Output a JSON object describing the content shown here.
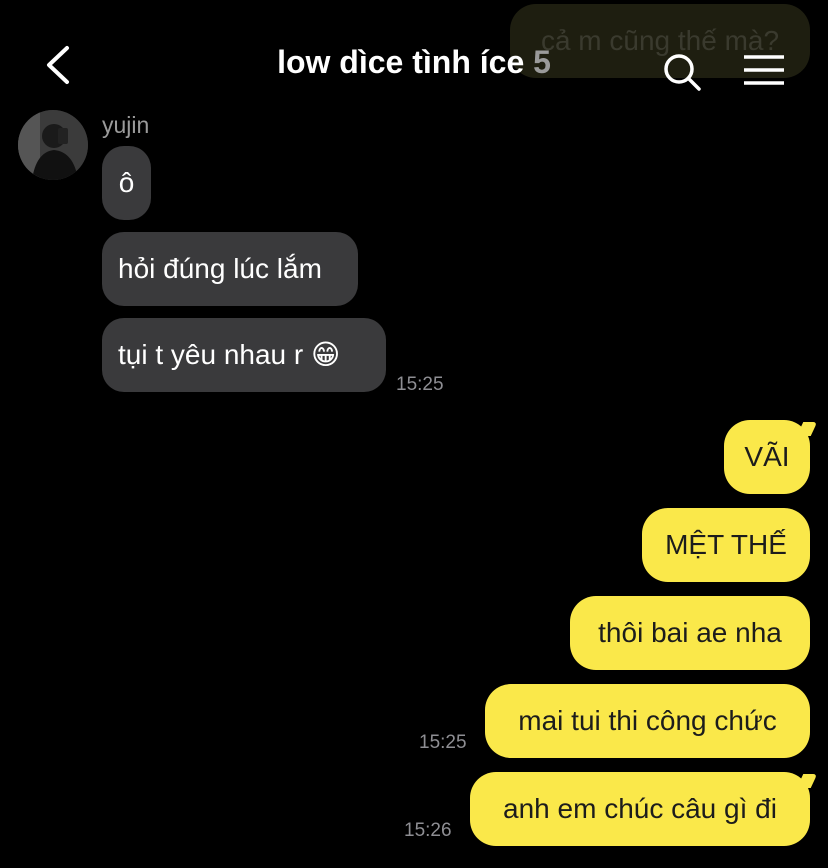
{
  "header": {
    "title": "low dìce tình íce",
    "member_count": "5",
    "back_icon": "chevron-left-icon",
    "search_icon": "search-icon",
    "menu_icon": "hamburger-menu-icon"
  },
  "previous_message": {
    "text": "cả m cũng thế mà?"
  },
  "incoming": {
    "sender": "yujin",
    "messages": [
      {
        "text": "ô"
      },
      {
        "text": "hỏi đúng lúc lắm"
      },
      {
        "text": "tụi t yêu nhau r 😁"
      }
    ],
    "time": "15:25"
  },
  "outgoing": {
    "messages": [
      {
        "text": "VÃI"
      },
      {
        "text": "MỆT THẾ"
      },
      {
        "text": "thôi bai ae nha"
      },
      {
        "text": "mai tui thi công chức"
      },
      {
        "text": "anh em chúc câu gì đi"
      }
    ],
    "time_1": "15:25",
    "time_2": "15:26"
  },
  "colors": {
    "background": "#000000",
    "incoming_bubble": "#3a3a3c",
    "outgoing_bubble": "#fae84a",
    "timestamp": "#8e8e93"
  }
}
